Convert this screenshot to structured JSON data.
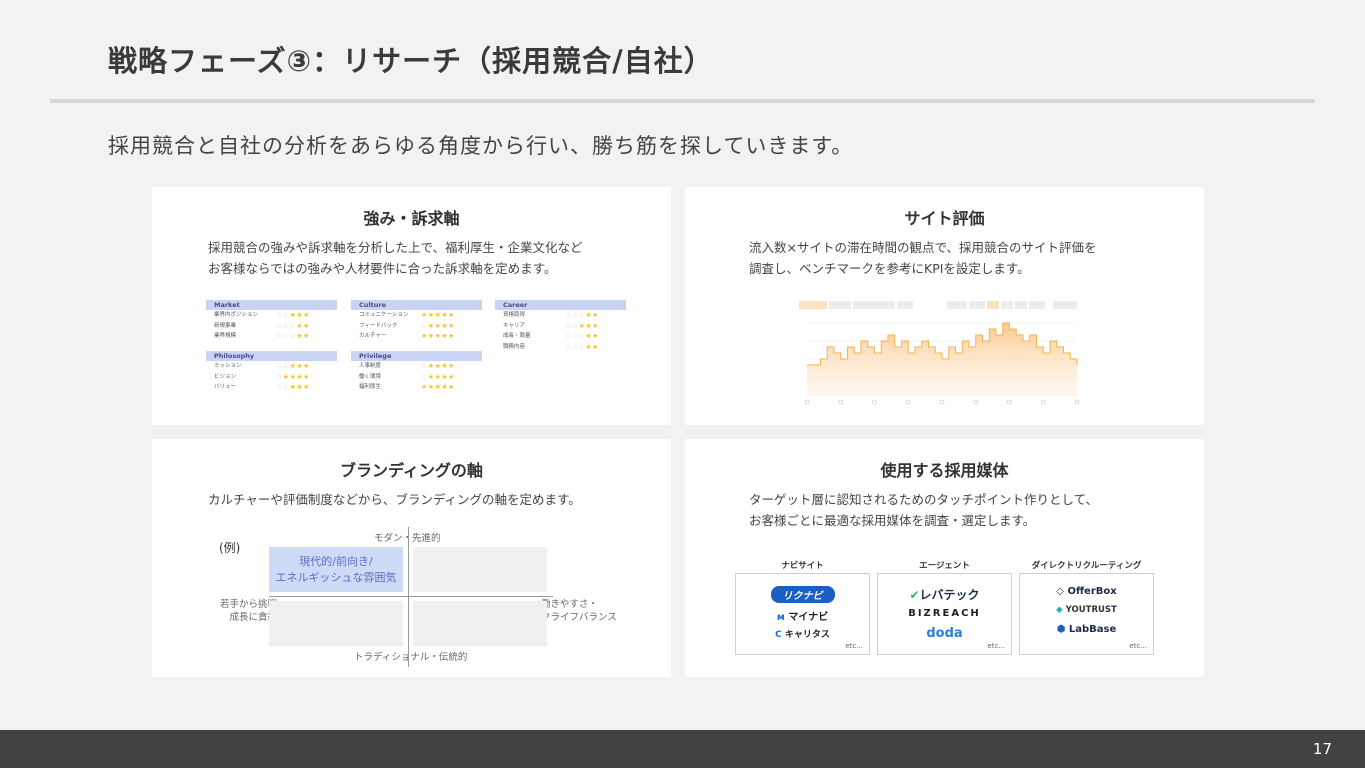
{
  "title": "戦略フェーズ③：リサーチ（採用競合/自社）",
  "subtitle": "採用競合と自社の分析をあらゆる角度から行い、勝ち筋を探していきます。",
  "cards": {
    "strengths": {
      "title": "強み・訴求軸",
      "desc": "採用競合の強みや訴求軸を分析した上で、福利厚生・企業文化など\nお客様ならではの強みや人材要件に合った訴求軸を定めます。",
      "tables": [
        {
          "header": "Market",
          "rows": [
            {
              "label": "業界内ポジション",
              "stars": 3
            },
            {
              "label": "新規事業",
              "stars": 2
            },
            {
              "label": "業界規模",
              "stars": 2
            }
          ]
        },
        {
          "header": "Culture",
          "rows": [
            {
              "label": "コミュニケーション",
              "stars": 5
            },
            {
              "label": "フィードバック",
              "stars": 4
            },
            {
              "label": "カルチャー",
              "stars": 5
            }
          ]
        },
        {
          "header": "Career",
          "rows": [
            {
              "label": "資格取得",
              "stars": 2
            },
            {
              "label": "キャリア",
              "stars": 3
            },
            {
              "label": "成長・裁量",
              "stars": 2
            },
            {
              "label": "職務内容",
              "stars": 2
            }
          ]
        },
        {
          "header": "Philosophy",
          "rows": [
            {
              "label": "ミッション",
              "stars": 3
            },
            {
              "label": "ビジョン",
              "stars": 4
            },
            {
              "label": "バリュー",
              "stars": 3
            }
          ]
        },
        {
          "header": "Privilege",
          "rows": [
            {
              "label": "人事制度",
              "stars": 4
            },
            {
              "label": "働く環境",
              "stars": 4
            },
            {
              "label": "福利厚生",
              "stars": 5
            }
          ]
        }
      ]
    },
    "site": {
      "title": "サイト評価",
      "desc": "流入数×サイトの滞在時間の観点で、採用競合のサイト評価を\n調査し、ベンチマークを参考にKPIを設定します。",
      "chart_data": {
        "type": "area",
        "values": [
          5,
          5,
          6,
          8,
          7,
          6,
          8,
          7,
          9,
          8,
          7,
          9,
          10,
          8,
          9,
          7,
          8,
          9,
          8,
          7,
          6,
          8,
          7,
          9,
          8,
          10,
          9,
          11,
          10,
          12,
          11,
          10,
          9,
          10,
          8,
          7,
          9,
          8,
          7,
          6,
          5
        ],
        "ylim": [
          0,
          12
        ],
        "color": "#f6b24b"
      }
    },
    "branding": {
      "title": "ブランディングの軸",
      "desc": "カルチャーや評価制度などから、ブランディングの軸を定めます。",
      "example": "(例)",
      "axis_top": "モダン・先進的",
      "axis_bottom": "トラディショナル・伝統的",
      "axis_left": "若手から挑戦・\n成長に貪欲",
      "axis_right": "働きやすさ・\nワークライフバランス",
      "highlight": "現代的/前向き/\nエネルギッシュな雰囲気"
    },
    "media": {
      "title": "使用する採用媒体",
      "desc": "ターゲット層に認知されるためのタッチポイント作りとして、\nお客様ごとに最適な採用媒体を調査・選定します。",
      "columns": [
        {
          "header": "ナビサイト",
          "logos": [
            "リクナビ",
            "マイナビ",
            "キャリタス"
          ],
          "etc": "etc..."
        },
        {
          "header": "エージェント",
          "logos": [
            "レバテック",
            "BIZREACH",
            "doda"
          ],
          "etc": "etc..."
        },
        {
          "header": "ダイレクトリクルーティング",
          "logos": [
            "OfferBox",
            "YOUTRUST",
            "LabBase"
          ],
          "etc": "etc..."
        }
      ]
    }
  },
  "page_number": "17"
}
